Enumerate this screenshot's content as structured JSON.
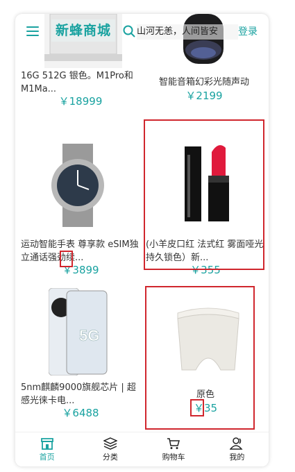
{
  "header": {
    "brand": "新蜂商城",
    "search_placeholder": "山河无恙，人间皆安",
    "login": "登录"
  },
  "products": [
    {
      "name": "16G 512G 银色。M1Pro和M1Ma...",
      "price": "￥18999"
    },
    {
      "name": "智能音箱幻彩光随声动",
      "price": "￥2199"
    },
    {
      "name": "运动智能手表 尊享款 eSIM独立通话强劲续...",
      "price": "￥3899"
    },
    {
      "name": "(小羊皮口红 法式红 雾面哑光 持久锁色）新...",
      "price": "￥355"
    },
    {
      "name": "5nm麒麟9000旗舰芯片 | 超感光徕卡电...",
      "price": "￥6488"
    },
    {
      "name": "原色",
      "price": "￥35"
    }
  ],
  "tabbar": [
    {
      "label": "首页",
      "icon": "home-icon",
      "active": true
    },
    {
      "label": "分类",
      "icon": "layers-icon",
      "active": false
    },
    {
      "label": "购物车",
      "icon": "cart-icon",
      "active": false
    },
    {
      "label": "我的",
      "icon": "user-icon",
      "active": false
    }
  ],
  "colors": {
    "accent": "#19a2a0",
    "highlight": "#d0262d"
  }
}
